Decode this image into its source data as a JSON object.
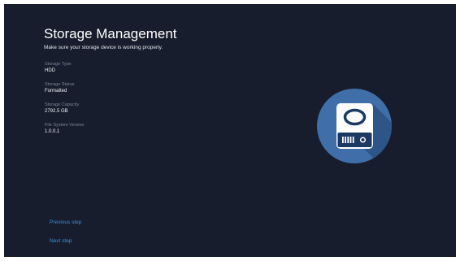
{
  "header": {
    "title": "Storage Management",
    "subtitle": "Make sure your storage device is working properly."
  },
  "storage_info": [
    {
      "label": "Storage Type",
      "value": "HDD"
    },
    {
      "label": "Storage Status",
      "value": "Formatted"
    },
    {
      "label": "Storage Capacity",
      "value": "2792.5 GB"
    },
    {
      "label": "File System Version",
      "value": "1.0.0.1"
    }
  ],
  "navigation": {
    "previous_label": "Previous step",
    "next_label": "Next step"
  },
  "icons": {
    "drive": "hard-drive-icon"
  },
  "colors": {
    "background": "#171d2c",
    "accent_circle": "#3f6ea9",
    "link": "#3d8fd6"
  }
}
